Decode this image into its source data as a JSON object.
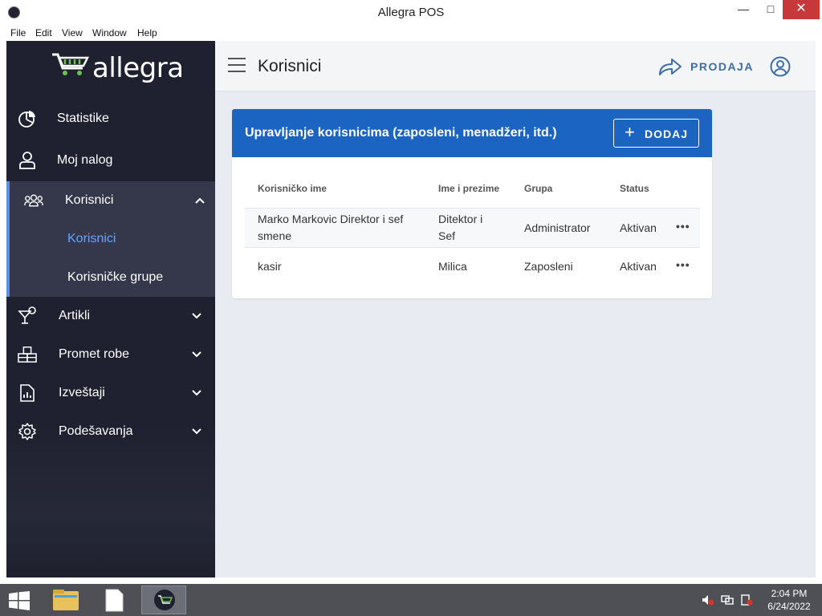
{
  "window": {
    "title": "Allegra POS",
    "minimize": "—",
    "maximize": "□",
    "close": "✕"
  },
  "menubar": [
    "File",
    "Edit",
    "View",
    "Window",
    "Help"
  ],
  "sidebar": {
    "logo": "allegra",
    "items": [
      {
        "label": "Statistike",
        "icon": "pie-chart-icon"
      },
      {
        "label": "Moj nalog",
        "icon": "user-icon"
      },
      {
        "label": "Korisnici",
        "icon": "users-icon",
        "expanded": true
      },
      {
        "label": "Artikli",
        "icon": "cocktail-icon"
      },
      {
        "label": "Promet robe",
        "icon": "boxes-icon"
      },
      {
        "label": "Izveštaji",
        "icon": "report-icon"
      },
      {
        "label": "Podešavanja",
        "icon": "gear-icon"
      }
    ],
    "subitems": [
      {
        "label": "Korisnici",
        "current": true
      },
      {
        "label": "Korisničke grupe",
        "current": false
      }
    ]
  },
  "header": {
    "title": "Korisnici",
    "prodaja_label": "PRODAJA"
  },
  "card": {
    "title": "Upravljanje korisnicima (zaposleni, menadžeri, itd.)",
    "add_label": "DODAJ",
    "columns": [
      "Korisničko ime",
      "Ime i prezime",
      "Grupa",
      "Status"
    ],
    "rows": [
      {
        "username_line1": "Marko Markovic Direktor i sef",
        "username_line2": "smene",
        "name_line1": "Ditektor i",
        "name_line2": "Sef",
        "group": "Administrator",
        "status": "Aktivan",
        "actions": "•••"
      },
      {
        "username": "kasir",
        "name": "Milica",
        "group": "Zaposleni",
        "status": "Aktivan",
        "actions": "•••"
      }
    ]
  },
  "taskbar": {
    "time": "2:04 PM",
    "date": "6/24/2022"
  },
  "colors": {
    "sidebar_bg": "#1f2130",
    "accent": "#1b64c2",
    "active_sub": "#6aa2ff",
    "content_bg": "#e8ebf1"
  }
}
